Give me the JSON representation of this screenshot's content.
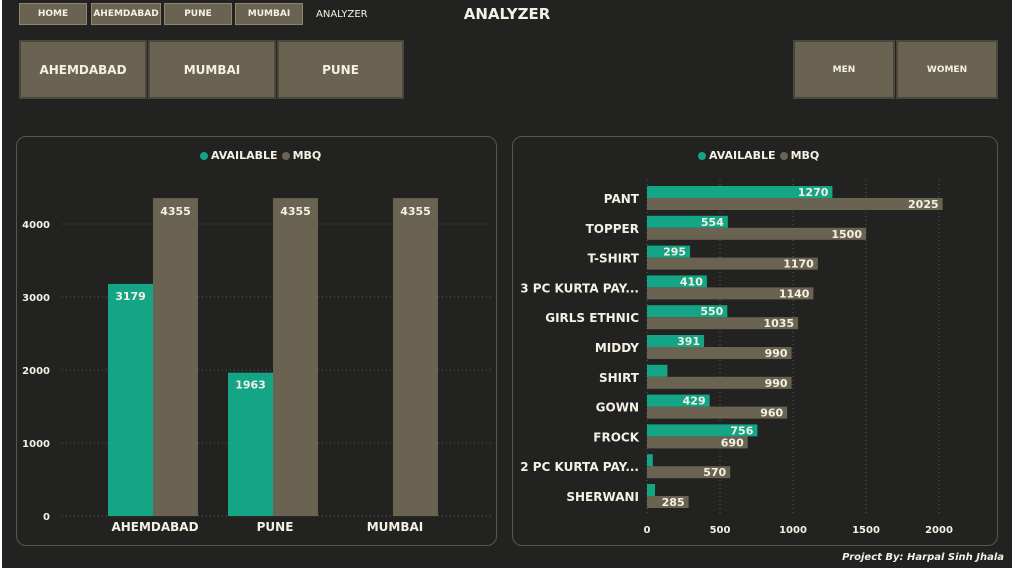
{
  "nav": {
    "buttons": [
      "HOME",
      "AHEMDABAD",
      "PUNE",
      "MUMBAI"
    ],
    "current": "ANALYZER"
  },
  "page_title": "ANALYZER",
  "city_slicer": [
    "AHEMDABAD",
    "MUMBAI",
    "PUNE"
  ],
  "gender_slicer": [
    "MEN",
    "WOMEN"
  ],
  "footer": "Project By: Harpal Sinh Jhala",
  "colors": {
    "available": "#13a585",
    "mbq": "#6b6352",
    "background": "#222220",
    "text": "#f4f0e4"
  },
  "chart_data": [
    {
      "type": "bar",
      "legend": [
        "AVAILABLE",
        "MBQ"
      ],
      "legend_position": "top-center",
      "categories": [
        "AHEMDABAD",
        "PUNE",
        "MUMBAI"
      ],
      "series": [
        {
          "name": "AVAILABLE",
          "values": [
            3179,
            1963,
            null
          ]
        },
        {
          "name": "MBQ",
          "values": [
            4355,
            4355,
            4355
          ]
        }
      ],
      "y_ticks": [
        0,
        1000,
        2000,
        3000,
        4000
      ],
      "ylim": [
        0,
        4600
      ],
      "grid": true
    },
    {
      "type": "bar",
      "orientation": "horizontal",
      "legend": [
        "AVAILABLE",
        "MBQ"
      ],
      "legend_position": "top-center",
      "categories": [
        "PANT",
        "TOPPER",
        "T-SHIRT",
        "3 PC KURTA PAY...",
        "GIRLS ETHNIC",
        "MIDDY",
        "SHIRT",
        "GOWN",
        "FROCK",
        "2 PC KURTA PAY...",
        "SHERWANI"
      ],
      "series": [
        {
          "name": "AVAILABLE",
          "values": [
            1270,
            554,
            295,
            410,
            550,
            391,
            140,
            429,
            756,
            40,
            55
          ]
        },
        {
          "name": "MBQ",
          "values": [
            2025,
            1500,
            1170,
            1140,
            1035,
            990,
            990,
            960,
            690,
            570,
            285
          ]
        }
      ],
      "available_labels": [
        "1270",
        "554",
        "295",
        "410",
        "550",
        "391",
        "",
        "429",
        "756",
        "",
        ""
      ],
      "mbq_labels": [
        "2025",
        "1500",
        "1170",
        "1140",
        "1035",
        "990",
        "990",
        "960",
        "690",
        "570",
        "285"
      ],
      "x_ticks": [
        0,
        500,
        1000,
        1500,
        2000
      ],
      "xlim": [
        0,
        2150
      ],
      "grid": true
    }
  ]
}
